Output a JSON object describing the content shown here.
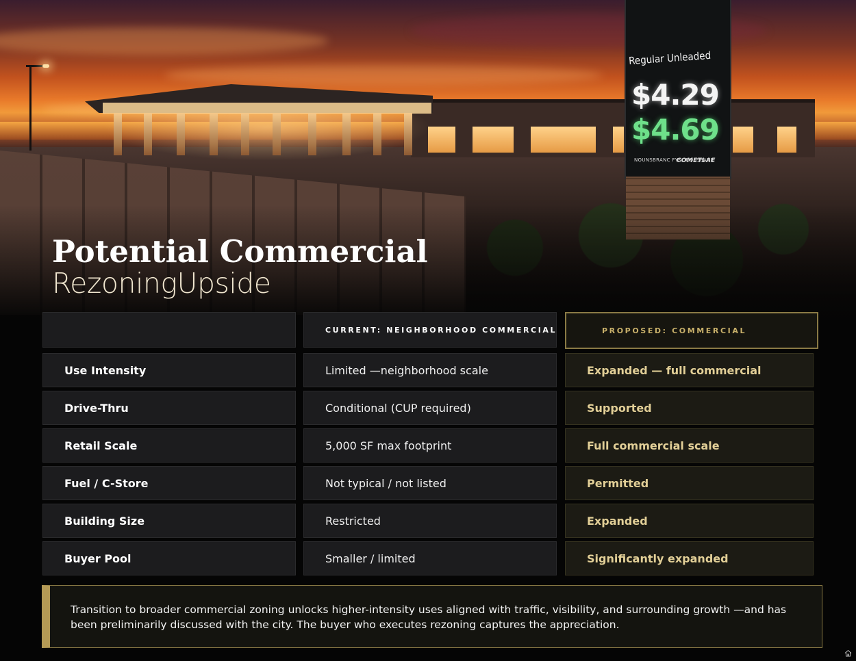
{
  "hero": {
    "sign_label": "Regular Unleaded",
    "price_regular": "$4.29",
    "price_premium": "$4.69",
    "sign_mini_1": "NOUNSBRANC FYNDROSSBANE",
    "sign_mini_2": "COMETLAE"
  },
  "title": {
    "line1": "Potential Commercial",
    "line2": "RezoningUpside"
  },
  "table": {
    "header_corner": "",
    "header_current": "CURRENT: NEIGHBORHOOD COMMERCIAL",
    "header_proposed": "PROPOSED: COMMERCIAL",
    "rows": [
      {
        "label": "Use Intensity",
        "current": "Limited —neighborhood scale",
        "proposed": "Expanded — full commercial"
      },
      {
        "label": "Drive-Thru",
        "current": "Conditional (CUP required)",
        "proposed": "Supported"
      },
      {
        "label": "Retail Scale",
        "current": "5,000 SF max footprint",
        "proposed": "Full commercial scale"
      },
      {
        "label": "Fuel / C-Store",
        "current": "Not typical / not listed",
        "proposed": "Permitted"
      },
      {
        "label": "Building Size",
        "current": "Restricted",
        "proposed": "Expanded"
      },
      {
        "label": "Buyer Pool",
        "current": "Smaller / limited",
        "proposed": "Significantly expanded"
      }
    ]
  },
  "note": {
    "text": "Transition to broader commercial zoning unlocks higher-intensity uses aligned with traffic, visibility, and surrounding growth —and has been preliminarily discussed with the city. The buyer who executes rezoning captures the appreciation."
  },
  "colors": {
    "accent_gold": "#b49a55",
    "proposed_text": "#e2cf97",
    "background": "#050505"
  },
  "icons": {
    "corner": "house-icon"
  }
}
